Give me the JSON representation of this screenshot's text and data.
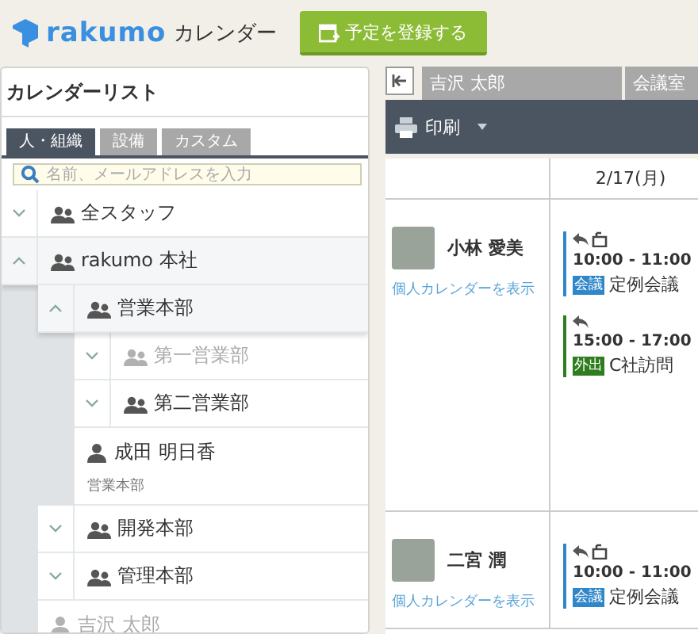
{
  "header": {
    "logo_text": "rakumo",
    "app_name": "カレンダー",
    "add_button": "予定を登録する"
  },
  "calendar_list": {
    "title": "カレンダーリスト",
    "tabs": [
      {
        "label": "人・組織",
        "selected": true
      },
      {
        "label": "設備",
        "selected": false
      },
      {
        "label": "カスタム",
        "selected": false
      }
    ],
    "search": {
      "placeholder": "名前、メールアドレスを入力"
    },
    "tree": [
      {
        "kind": "group",
        "label": "全スタッフ",
        "expanded": false,
        "disabled": false
      },
      {
        "kind": "group",
        "label": "rakumo 本社",
        "expanded": true,
        "disabled": false,
        "children": [
          {
            "kind": "group",
            "label": "営業本部",
            "expanded": true,
            "disabled": false,
            "children": [
              {
                "kind": "group",
                "label": "第一営業部",
                "expanded": false,
                "disabled": true
              },
              {
                "kind": "group",
                "label": "第二営業部",
                "expanded": false,
                "disabled": false
              },
              {
                "kind": "person",
                "label": "成田 明日香",
                "sub": "営業本部",
                "disabled": false
              }
            ]
          },
          {
            "kind": "group",
            "label": "開発本部",
            "expanded": false,
            "disabled": false
          },
          {
            "kind": "group",
            "label": "管理本部",
            "expanded": false,
            "disabled": false
          },
          {
            "kind": "person",
            "label": "吉沢 太郎",
            "disabled": true
          }
        ]
      }
    ]
  },
  "schedule": {
    "tabs": [
      {
        "label": "吉沢 太郎"
      },
      {
        "label": "会議室"
      }
    ],
    "toolbar": {
      "print": "印刷"
    },
    "date": "2/17(月)",
    "rows": [
      {
        "name": "小林 愛美",
        "link": "個人カレンダーを表示",
        "events": [
          {
            "repeating": true,
            "time": "10:00 - 11:00",
            "tag": "会議",
            "color": "#2f86c8",
            "title": "定例会議"
          },
          {
            "repeating": false,
            "time": "15:00 - 17:00",
            "tag": "外出",
            "color": "#2e7d1e",
            "title": "C社訪問"
          }
        ]
      },
      {
        "name": "二宮 潤",
        "link": "個人カレンダーを表示",
        "events": [
          {
            "repeating": true,
            "time": "10:00 - 11:00",
            "tag": "会議",
            "color": "#2f86c8",
            "title": "定例会議"
          }
        ]
      }
    ]
  }
}
